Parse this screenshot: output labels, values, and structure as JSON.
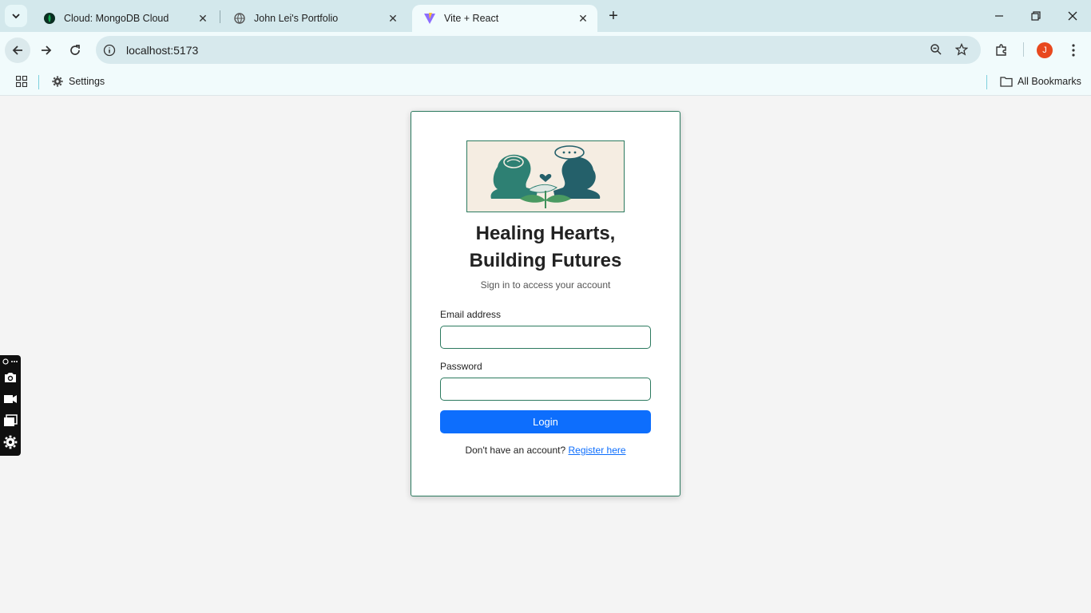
{
  "browser": {
    "tabs": [
      {
        "title": "Cloud: MongoDB Cloud",
        "icon": "mongodb-leaf-icon"
      },
      {
        "title": "John Lei's Portfolio",
        "icon": "globe-icon"
      },
      {
        "title": "Vite + React",
        "icon": "vite-icon",
        "active": true
      }
    ],
    "url": "localhost:5173",
    "profile_initial": "J",
    "bookmarks": [
      {
        "label": "Settings",
        "icon": "gear-icon"
      }
    ],
    "all_bookmarks_label": "All Bookmarks"
  },
  "login": {
    "title_line1": "Healing Hearts,",
    "title_line2": "Building Futures",
    "subtitle": "Sign in to access your account",
    "email_label": "Email address",
    "email_value": "",
    "password_label": "Password",
    "password_value": "",
    "login_button": "Login",
    "register_prompt": "Don't have an account?",
    "register_link": "Register here"
  },
  "colors": {
    "accent_green": "#2c7a5f",
    "primary_button": "#0d6efd",
    "tabstrip": "#d3e8ec",
    "page_background": "#f4f4f4"
  }
}
